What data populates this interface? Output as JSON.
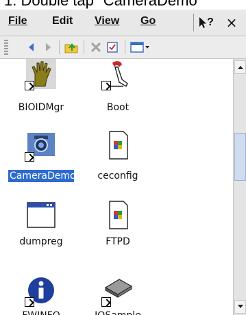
{
  "caption": {
    "text": "1.  Double tap \"CameraDemo\""
  },
  "menu": {
    "items": [
      {
        "label": "File"
      },
      {
        "label": "Edit"
      },
      {
        "label": "View"
      },
      {
        "label": "Go"
      }
    ],
    "help_label": "?",
    "close_label": "×"
  },
  "toolbar": {
    "buttons": [
      {
        "name": "back",
        "icon": "back-arrow-icon"
      },
      {
        "name": "forward",
        "icon": "forward-arrow-icon"
      },
      {
        "name": "up",
        "icon": "up-folder-icon"
      },
      {
        "name": "delete",
        "icon": "delete-icon"
      },
      {
        "name": "properties",
        "icon": "properties-icon"
      },
      {
        "name": "view-menu",
        "icon": "view-menu-icon"
      }
    ]
  },
  "files": [
    {
      "label": "BIOIDMgr",
      "icon": "hand-icon"
    },
    {
      "label": "Boot",
      "icon": "boot-icon"
    },
    {
      "label": "CameraDemo",
      "icon": "camera-icon",
      "selected": true
    },
    {
      "label": "ceconfig",
      "icon": "document-icon"
    },
    {
      "label": "dumpreg",
      "icon": "window-icon"
    },
    {
      "label": "FTPD",
      "icon": "document-icon"
    },
    {
      "label": "FWINFO",
      "icon": "info-icon"
    },
    {
      "label": "IOSample",
      "icon": "chip-icon"
    }
  ],
  "colors": {
    "selection": "#2e6bd1",
    "menubar": "#e8e8e8",
    "toolbar": "#ececec"
  }
}
